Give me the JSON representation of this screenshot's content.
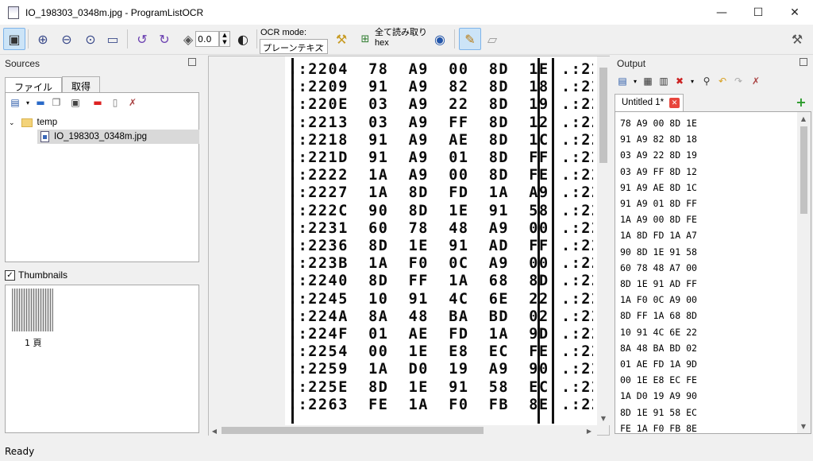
{
  "window": {
    "title": "IO_198303_0348m.jpg - ProgramListOCR",
    "minimize": "—",
    "maximize": "☐",
    "close": "✕"
  },
  "toolbar": {
    "rotation_value": "0.0",
    "ocr_mode_label": "OCR mode:",
    "ocr_mode_value": "プレーンテキスト",
    "read_all_label": "全て読み取り",
    "read_all_sub": "hex"
  },
  "sources": {
    "title": "Sources",
    "tabs": [
      "ファイル",
      "取得"
    ],
    "tree": {
      "folder": "temp",
      "file": "IO_198303_0348m.jpg"
    }
  },
  "thumbnails": {
    "label": "Thumbnails",
    "checked": true,
    "items": [
      {
        "caption": "1 頁"
      }
    ]
  },
  "scan": {
    "lines": [
      ".:2204  78  A9  00  8D  1E",
      ".:2209  91  A9  82  8D  18",
      ".:220E  03  A9  22  8D  19",
      ".:2213  03  A9  FF  8D  12",
      ".:2218  91  A9  AE  8D  1C",
      ".:221D  91  A9  01  8D  FF",
      ".:2222  1A  A9  00  8D  FE",
      ".:2227  1A  8D  FD  1A  A9",
      ".:222C  90  8D  1E  91  58",
      ".:2231  60  78  48  A9  00",
      ".:2236  8D  1E  91  AD  FF",
      ".:223B  1A  F0  0C  A9  00",
      ".:2240  8D  FF  1A  68  8D",
      ".:2245  10  91  4C  6E  22",
      ".:224A  8A  48  BA  BD  02",
      ".:224F  01  AE  FD  1A  9D",
      ".:2254  00  1E  E8  EC  FE",
      ".:2259  1A  D0  19  A9  90",
      ".:225E  8D  1E  91  58  EC",
      ".:2263  FE  1A  F0  FB  8E"
    ]
  },
  "output": {
    "title": "Output",
    "tab_label": "Untitled 1*",
    "lines": [
      "78 A9 00 8D 1E",
      "91 A9 82 8D 18",
      "03 A9 22 8D 19",
      "03 A9 FF 8D 12",
      "91 A9 AE 8D 1C",
      "91 A9 01 8D FF",
      "1A A9 00 8D FE",
      "1A 8D FD 1A A7",
      "90 8D 1E 91 58",
      "60 78 48 A7 00",
      "8D 1E 91 AD FF",
      "1A F0 0C A9 00",
      "8D FF 1A 68 8D",
      "10 91 4C 6E 22",
      "8A 48 BA BD 02",
      "01 AE FD 1A 9D",
      "00 1E E8 EC FE",
      "1A D0 19 A9 90",
      "8D 1E 91 58 EC",
      "FE 1A F0 FB 8E"
    ]
  },
  "status": {
    "text": "Ready"
  }
}
